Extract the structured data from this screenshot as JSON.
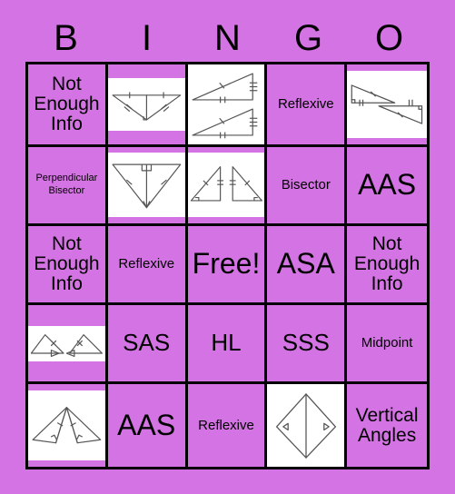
{
  "card": {
    "background_color": "#d473e3",
    "border_color": "#000000",
    "cell_fill_color": "#d473e3",
    "image_background_color": "#ffffff",
    "diagram_stroke_color": "#555555"
  },
  "header": {
    "letters": [
      "B",
      "I",
      "N",
      "G",
      "O"
    ]
  },
  "grid": {
    "rows": [
      [
        {
          "kind": "text",
          "label": "Not\nEnough\nInfo",
          "size": "md"
        },
        {
          "kind": "image",
          "label": "triangle-with-median-diagram",
          "band": "mid"
        },
        {
          "kind": "image",
          "label": "two-right-triangles-stacked-diagram",
          "band": "full"
        },
        {
          "kind": "text",
          "label": "Reflexive",
          "size": "sm"
        },
        {
          "kind": "image",
          "label": "two-right-triangles-z-shape-diagram",
          "band": "wide"
        }
      ],
      [
        {
          "kind": "text",
          "label": "Perpendicular\nBisector",
          "size": "xs"
        },
        {
          "kind": "image",
          "label": "inverted-triangle-with-altitude-diagram",
          "band": "wide"
        },
        {
          "kind": "image",
          "label": "two-mirrored-right-triangles-diagram",
          "band": "wide"
        },
        {
          "kind": "text",
          "label": "Bisector",
          "size": "sm"
        },
        {
          "kind": "text",
          "label": "AAS",
          "size": "xl"
        }
      ],
      [
        {
          "kind": "text",
          "label": "Not\nEnough\nInfo",
          "size": "md"
        },
        {
          "kind": "text",
          "label": "Reflexive",
          "size": "sm"
        },
        {
          "kind": "text",
          "label": "Free!",
          "size": "xl"
        },
        {
          "kind": "text",
          "label": "ASA",
          "size": "xl"
        },
        {
          "kind": "text",
          "label": "Not\nEnough\nInfo",
          "size": "md"
        }
      ],
      [
        {
          "kind": "image",
          "label": "two-small-triangles-with-arrows-diagram",
          "band": "thin"
        },
        {
          "kind": "text",
          "label": "SAS",
          "size": "lg"
        },
        {
          "kind": "text",
          "label": "HL",
          "size": "lg"
        },
        {
          "kind": "text",
          "label": "SSS",
          "size": "lg"
        },
        {
          "kind": "text",
          "label": "Midpoint",
          "size": "sm"
        }
      ],
      [
        {
          "kind": "image",
          "label": "two-triangles-shared-apex-diagram",
          "band": "wide"
        },
        {
          "kind": "text",
          "label": "AAS",
          "size": "xl"
        },
        {
          "kind": "text",
          "label": "Reflexive",
          "size": "sm"
        },
        {
          "kind": "image",
          "label": "kite-with-diagonal-diagram",
          "band": "full"
        },
        {
          "kind": "text",
          "label": "Vertical\nAngles",
          "size": "md"
        }
      ]
    ]
  }
}
